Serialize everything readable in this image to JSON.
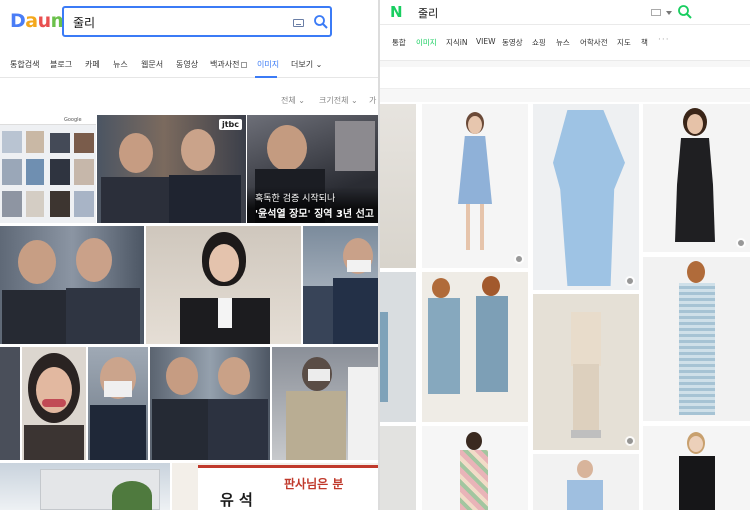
{
  "daum": {
    "logo": "Daum",
    "search": {
      "query": "줄리"
    },
    "tabs": [
      {
        "label": "통합검색"
      },
      {
        "label": "블로그"
      },
      {
        "label": "카페"
      },
      {
        "label": "뉴스"
      },
      {
        "label": "웹문서"
      },
      {
        "label": "동영상"
      },
      {
        "label": "백과사전"
      },
      {
        "label": "이미지",
        "active": true
      },
      {
        "label": "더보기"
      }
    ],
    "filters": [
      "전체",
      "크기전체",
      "가"
    ],
    "captions": {
      "news_line1": "혹독한 검증 시작되나",
      "news_line2": "'윤석열 장모' 징역 3년 선고",
      "jtbc_badge": "jtbc",
      "google_label": "Google",
      "banner_text": "판사님은 분",
      "banner_text2": "유 석"
    }
  },
  "naver": {
    "logo": "N",
    "search": {
      "query": "줄리"
    },
    "tabs": [
      {
        "label": "통합"
      },
      {
        "label": "이미지",
        "active": true
      },
      {
        "label": "지식iN"
      },
      {
        "label": "VIEW"
      },
      {
        "label": "동영상"
      },
      {
        "label": "쇼핑"
      },
      {
        "label": "뉴스"
      },
      {
        "label": "어학사전"
      },
      {
        "label": "지도"
      },
      {
        "label": "책"
      }
    ],
    "more": "···"
  },
  "colors": {
    "daum_accent": "#3b7bf6",
    "naver_green": "#19ce60"
  }
}
